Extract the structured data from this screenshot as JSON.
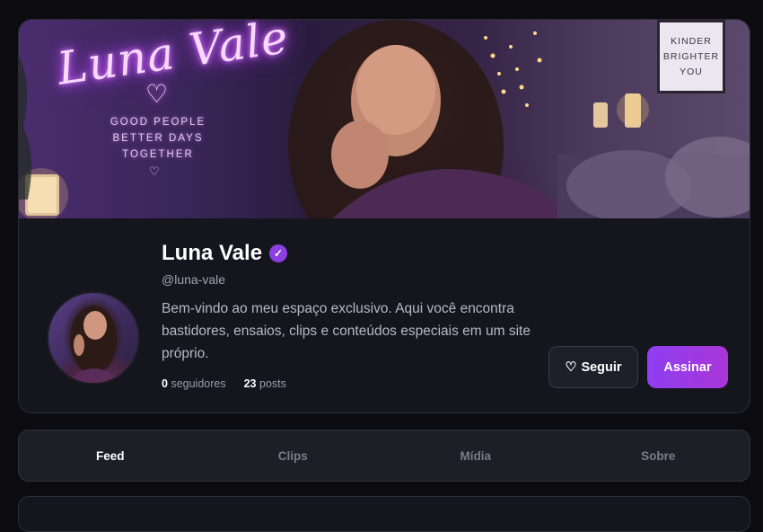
{
  "banner": {
    "neon_title": "Luna Vale",
    "neon_heart": "♡",
    "neon_lines": [
      "GOOD PEOPLE",
      "BETTER DAYS",
      "TOGETHER"
    ],
    "neon_small_heart": "♡",
    "poster_lines": [
      "KINDER",
      "BRIGHTER",
      "YOU"
    ]
  },
  "profile": {
    "name": "Luna Vale",
    "verified_icon": "✓",
    "handle": "@luna-vale",
    "bio": "Bem-vindo ao meu espaço exclusivo. Aqui você encontra bastidores, ensaios, clips e conteúdos especiais em um site próprio.",
    "followers_count": "0",
    "followers_label": "seguidores",
    "posts_count": "23",
    "posts_label": "posts"
  },
  "actions": {
    "follow_icon": "♡",
    "follow_label": "Seguir",
    "subscribe_label": "Assinar"
  },
  "tabs": [
    {
      "label": "Feed",
      "active": true
    },
    {
      "label": "Clips",
      "active": false
    },
    {
      "label": "Mídia",
      "active": false
    },
    {
      "label": "Sobre",
      "active": false
    }
  ],
  "colors": {
    "accent": "#8e3ef1",
    "background": "#0b0b10",
    "card": "#15161d"
  }
}
